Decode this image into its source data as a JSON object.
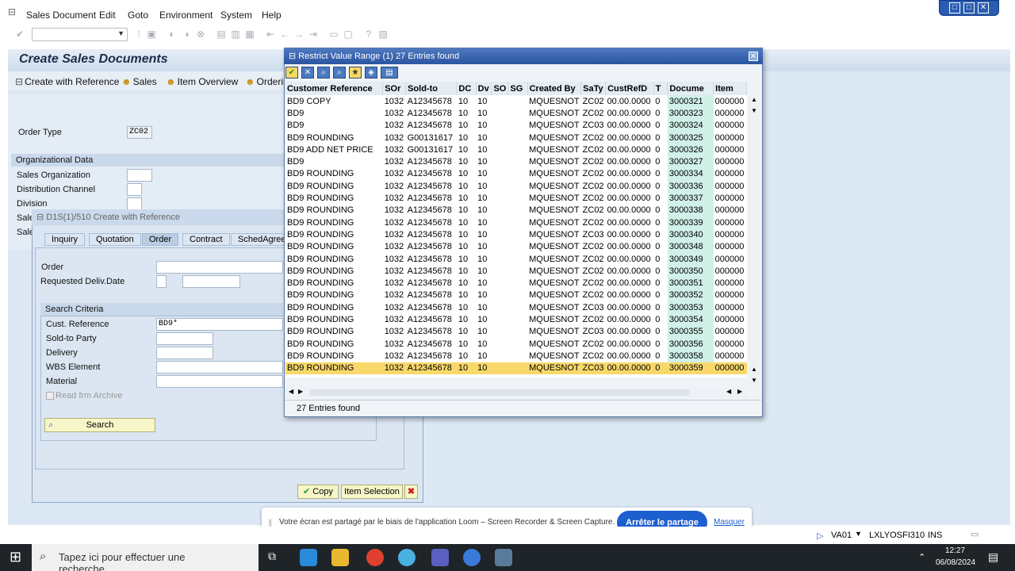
{
  "menu": {
    "items": [
      "Sales Document",
      "Edit",
      "Goto",
      "Environment",
      "System",
      "Help"
    ]
  },
  "window_controls": [
    "□",
    "□",
    "✕"
  ],
  "page": {
    "title": "Create Sales Documents"
  },
  "app_toolbar": {
    "buttons": [
      "Create with Reference",
      "Sales",
      "Item Overview",
      "Orderin"
    ]
  },
  "order_type": {
    "label": "Order Type",
    "value": "ZC02"
  },
  "org_data": {
    "header": "Organizational Data",
    "fields": [
      "Sales Organization",
      "Distribution Channel",
      "Division",
      "Sale",
      "Sale"
    ]
  },
  "ref_dialog": {
    "title": "D1S(1)/510 Create with Reference",
    "tabs": [
      "Inquiry",
      "Quotation",
      "Order",
      "Contract",
      "SchedAgree"
    ],
    "order_label": "Order",
    "req_deliv_label": "Requested Deliv.Date",
    "search_criteria": "Search Criteria",
    "fields": [
      {
        "label": "Cust. Reference",
        "value": "BD9*"
      },
      {
        "label": "Sold-to Party",
        "value": ""
      },
      {
        "label": "Delivery",
        "value": ""
      },
      {
        "label": "WBS Element",
        "value": ""
      },
      {
        "label": "Material",
        "value": ""
      }
    ],
    "archive_label": "Read frm Archive",
    "search_btn": "Search",
    "copy_btn": "Copy",
    "item_sel_btn": "Item Selection"
  },
  "popup": {
    "title": "Restrict Value Range (1)   27 Entries found",
    "status": "27 Entries found",
    "columns": [
      "Customer Reference",
      "SOr",
      "Sold-to",
      "DC",
      "Dv",
      "SO",
      "SG",
      "Created By",
      "SaTy",
      "CustRefD",
      "T",
      "Docume",
      "Item"
    ],
    "rows": [
      [
        "BD9 COPY",
        "1032",
        "A12345678",
        "10",
        "10",
        "",
        "",
        "MQUESNOT",
        "ZC02",
        "00.00.0000",
        "0",
        "3000321",
        "000000"
      ],
      [
        "BD9",
        "1032",
        "A12345678",
        "10",
        "10",
        "",
        "",
        "MQUESNOT",
        "ZC02",
        "00.00.0000",
        "0",
        "3000323",
        "000000"
      ],
      [
        "BD9",
        "1032",
        "A12345678",
        "10",
        "10",
        "",
        "",
        "MQUESNOT",
        "ZC03",
        "00.00.0000",
        "0",
        "3000324",
        "000000"
      ],
      [
        "BD9 ROUNDING",
        "1032",
        "G00131617",
        "10",
        "10",
        "",
        "",
        "MQUESNOT",
        "ZC02",
        "00.00.0000",
        "0",
        "3000325",
        "000000"
      ],
      [
        "BD9 ADD NET PRICE",
        "1032",
        "G00131617",
        "10",
        "10",
        "",
        "",
        "MQUESNOT",
        "ZC02",
        "00.00.0000",
        "0",
        "3000326",
        "000000"
      ],
      [
        "BD9",
        "1032",
        "A12345678",
        "10",
        "10",
        "",
        "",
        "MQUESNOT",
        "ZC02",
        "00.00.0000",
        "0",
        "3000327",
        "000000"
      ],
      [
        "BD9 ROUNDING",
        "1032",
        "A12345678",
        "10",
        "10",
        "",
        "",
        "MQUESNOT",
        "ZC02",
        "00.00.0000",
        "0",
        "3000334",
        "000000"
      ],
      [
        "BD9 ROUNDING",
        "1032",
        "A12345678",
        "10",
        "10",
        "",
        "",
        "MQUESNOT",
        "ZC02",
        "00.00.0000",
        "0",
        "3000336",
        "000000"
      ],
      [
        "BD9 ROUNDING",
        "1032",
        "A12345678",
        "10",
        "10",
        "",
        "",
        "MQUESNOT",
        "ZC02",
        "00.00.0000",
        "0",
        "3000337",
        "000000"
      ],
      [
        "BD9 ROUNDING",
        "1032",
        "A12345678",
        "10",
        "10",
        "",
        "",
        "MQUESNOT",
        "ZC02",
        "00.00.0000",
        "0",
        "3000338",
        "000000"
      ],
      [
        "BD9 ROUNDING",
        "1032",
        "A12345678",
        "10",
        "10",
        "",
        "",
        "MQUESNOT",
        "ZC02",
        "00.00.0000",
        "0",
        "3000339",
        "000000"
      ],
      [
        "BD9 ROUNDING",
        "1032",
        "A12345678",
        "10",
        "10",
        "",
        "",
        "MQUESNOT",
        "ZC03",
        "00.00.0000",
        "0",
        "3000340",
        "000000"
      ],
      [
        "BD9 ROUNDING",
        "1032",
        "A12345678",
        "10",
        "10",
        "",
        "",
        "MQUESNOT",
        "ZC02",
        "00.00.0000",
        "0",
        "3000348",
        "000000"
      ],
      [
        "BD9 ROUNDING",
        "1032",
        "A12345678",
        "10",
        "10",
        "",
        "",
        "MQUESNOT",
        "ZC02",
        "00.00.0000",
        "0",
        "3000349",
        "000000"
      ],
      [
        "BD9 ROUNDING",
        "1032",
        "A12345678",
        "10",
        "10",
        "",
        "",
        "MQUESNOT",
        "ZC02",
        "00.00.0000",
        "0",
        "3000350",
        "000000"
      ],
      [
        "BD9 ROUNDING",
        "1032",
        "A12345678",
        "10",
        "10",
        "",
        "",
        "MQUESNOT",
        "ZC02",
        "00.00.0000",
        "0",
        "3000351",
        "000000"
      ],
      [
        "BD9 ROUNDING",
        "1032",
        "A12345678",
        "10",
        "10",
        "",
        "",
        "MQUESNOT",
        "ZC02",
        "00.00.0000",
        "0",
        "3000352",
        "000000"
      ],
      [
        "BD9 ROUNDING",
        "1032",
        "A12345678",
        "10",
        "10",
        "",
        "",
        "MQUESNOT",
        "ZC03",
        "00.00.0000",
        "0",
        "3000353",
        "000000"
      ],
      [
        "BD9 ROUNDING",
        "1032",
        "A12345678",
        "10",
        "10",
        "",
        "",
        "MQUESNOT",
        "ZC02",
        "00.00.0000",
        "0",
        "3000354",
        "000000"
      ],
      [
        "BD9 ROUNDING",
        "1032",
        "A12345678",
        "10",
        "10",
        "",
        "",
        "MQUESNOT",
        "ZC03",
        "00.00.0000",
        "0",
        "3000355",
        "000000"
      ],
      [
        "BD9 ROUNDING",
        "1032",
        "A12345678",
        "10",
        "10",
        "",
        "",
        "MQUESNOT",
        "ZC02",
        "00.00.0000",
        "0",
        "3000356",
        "000000"
      ],
      [
        "BD9 ROUNDING",
        "1032",
        "A12345678",
        "10",
        "10",
        "",
        "",
        "MQUESNOT",
        "ZC02",
        "00.00.0000",
        "0",
        "3000358",
        "000000"
      ],
      [
        "BD9 ROUNDING",
        "1032",
        "A12345678",
        "10",
        "10",
        "",
        "",
        "MQUESNOT",
        "ZC03",
        "00.00.0000",
        "0",
        "3000359",
        "000000"
      ]
    ],
    "selected_row": 22
  },
  "loom": {
    "text": "Votre écran est partagé par le biais de l'application Loom – Screen Recorder & Screen Capture.",
    "stop": "Arrêter le partage",
    "hide": "Masquer"
  },
  "status_bar": {
    "tcode": "VA01",
    "system": "LXLYOSFI310",
    "mode": "INS"
  },
  "taskbar": {
    "search": "Tapez ici pour effectuer une recherche",
    "time": "12:27",
    "date": "06/08/2024"
  }
}
